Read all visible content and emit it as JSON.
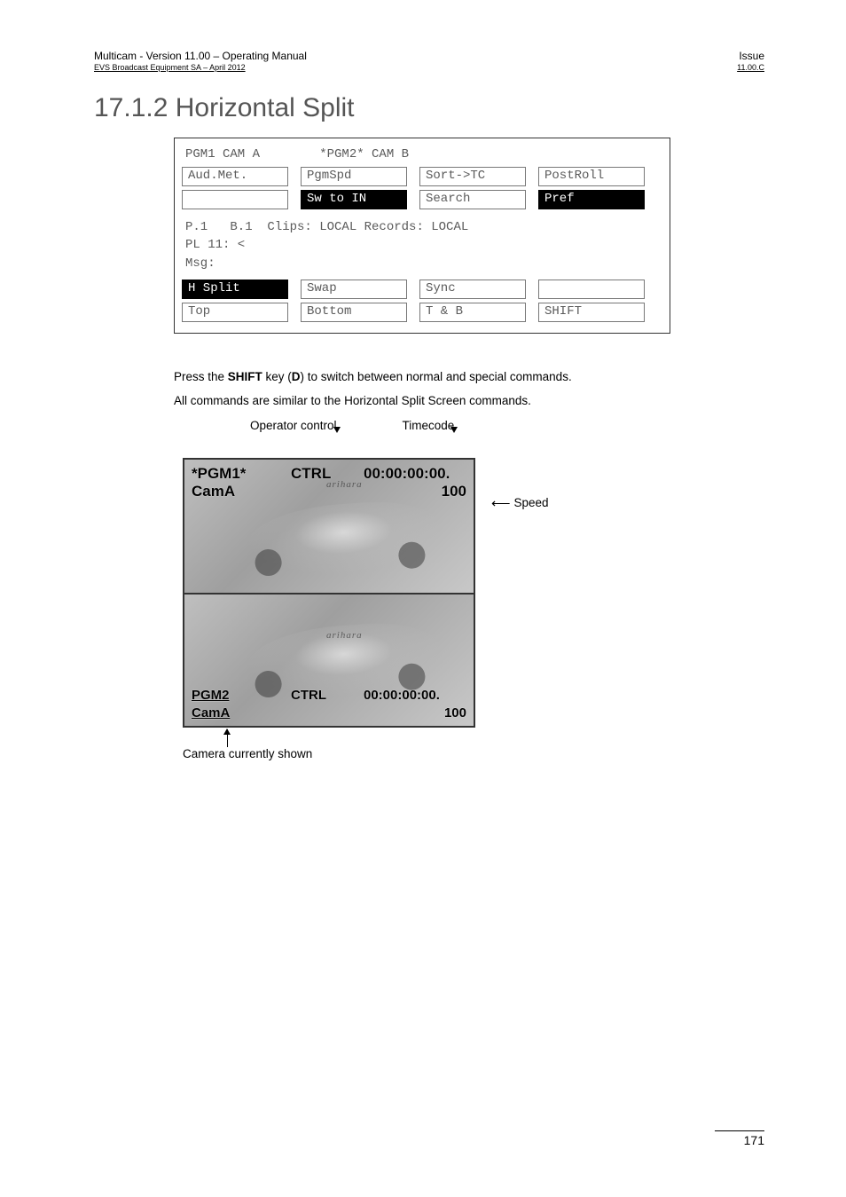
{
  "header": {
    "left_top": "Multicam - Version 11.00 – Operating Manual",
    "left_sub": "EVS Broadcast Equipment SA – April 2012",
    "right_top": "Issue",
    "right_sub": "11.00.C"
  },
  "section_title": "17.1.2 Horizontal Split",
  "panel": {
    "title_line": "PGM1 CAM A        *PGM2* CAM B",
    "row1": [
      "Aud.Met.",
      "PgmSpd",
      "Sort->TC",
      "PostRoll"
    ],
    "row2": [
      "",
      "Sw to IN",
      "Search",
      "Pref"
    ],
    "row2_inverted": [
      false,
      true,
      false,
      true
    ],
    "status": "P.1   B.1  Clips: LOCAL Records: LOCAL\nPL 11: <\nMsg:",
    "row3": [
      "H Split",
      "Swap",
      "Sync",
      ""
    ],
    "row3_inverted": [
      true,
      false,
      false,
      false
    ],
    "row4": [
      "Top",
      "Bottom",
      "T & B",
      "SHIFT"
    ]
  },
  "body": {
    "p1_pre": "Press the ",
    "p1_shift": "SHIFT",
    "p1_mid": " key (",
    "p1_d": "D",
    "p1_post": ") to switch between normal and special commands.",
    "p2": "All commands are similar to the Horizontal Split Screen commands."
  },
  "diagram": {
    "labels": {
      "operator": "Operator control",
      "timecode": "Timecode",
      "speed": "Speed",
      "camera_shown": "Camera currently shown"
    },
    "screen1": {
      "pgm": "*PGM1*",
      "cam": "CamA",
      "ctrl": "CTRL",
      "tc": "00:00:00:00.",
      "spd": "100",
      "watermark": "arihara"
    },
    "screen2": {
      "pgm": "PGM2",
      "cam": "CamA",
      "ctrl": "CTRL",
      "tc": "00:00:00:00.",
      "spd": "100",
      "watermark": "arihara"
    }
  },
  "page_number": "171"
}
